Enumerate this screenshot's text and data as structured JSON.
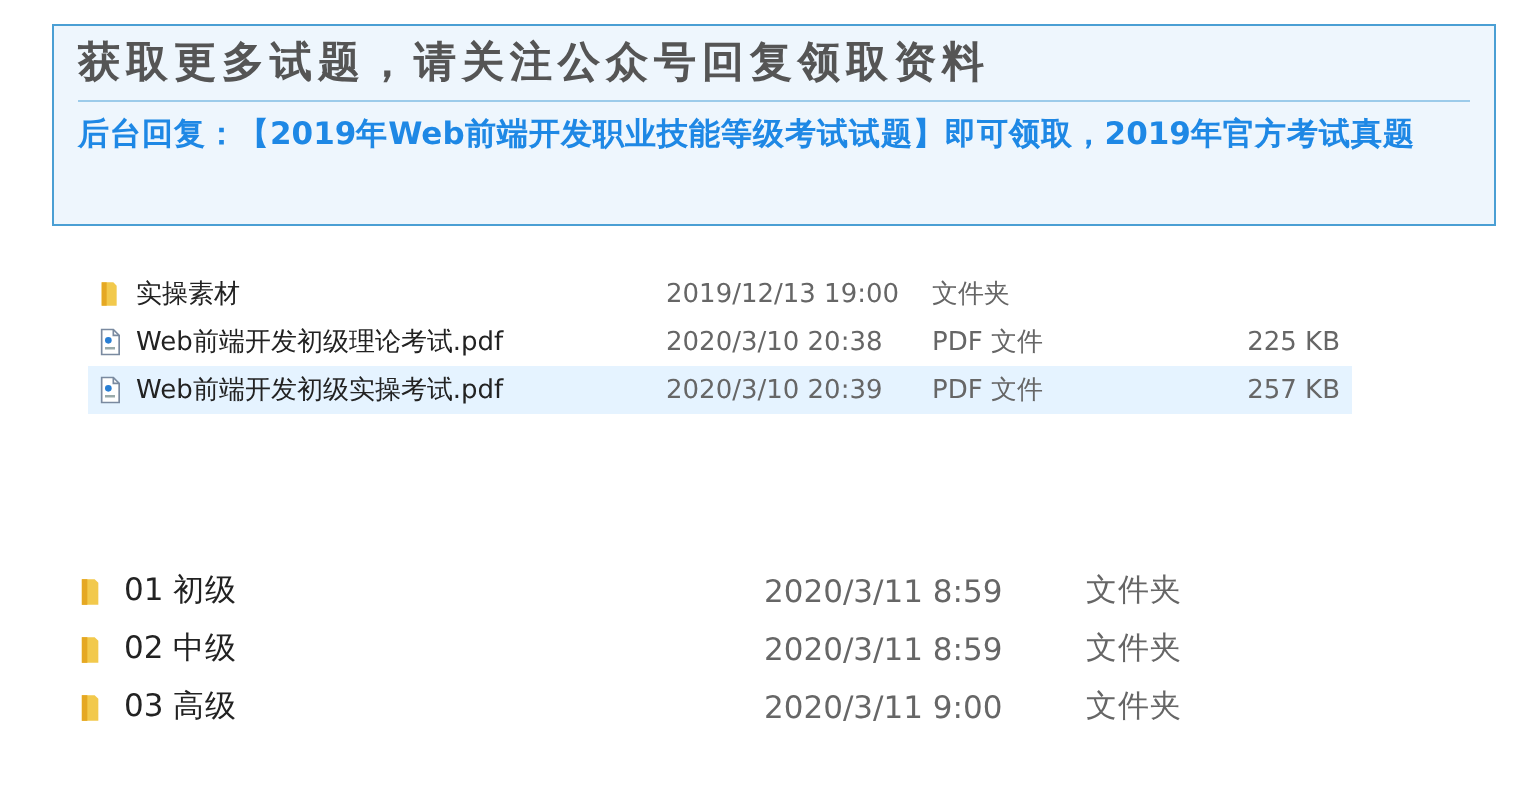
{
  "banner": {
    "title": "获取更多试题，请关注公众号回复领取资料",
    "message": "后台回复：【2019年Web前端开发职业技能等级考试试题】即可领取，2019年官方考试真题"
  },
  "file_list": [
    {
      "kind": "folder",
      "name": "实操素材",
      "modified": "2019/12/13 19:00",
      "type": "文件夹",
      "selected": false
    },
    {
      "kind": "pdf",
      "name": "Web前端开发初级理论考试.pdf",
      "modified": "2020/3/10 20:38",
      "type": "PDF 文件",
      "size": "225 KB",
      "selected": false
    },
    {
      "kind": "pdf",
      "name": "Web前端开发初级实操考试.pdf",
      "modified": "2020/3/10 20:39",
      "type": "PDF 文件",
      "size": "257 KB",
      "selected": true
    }
  ],
  "folder_list": [
    {
      "kind": "folder",
      "name": "01 初级",
      "modified": "2020/3/11 8:59",
      "type": "文件夹"
    },
    {
      "kind": "folder",
      "name": "02 中级",
      "modified": "2020/3/11 8:59",
      "type": "文件夹"
    },
    {
      "kind": "folder",
      "name": "03 高级",
      "modified": "2020/3/11 9:00",
      "type": "文件夹"
    }
  ]
}
